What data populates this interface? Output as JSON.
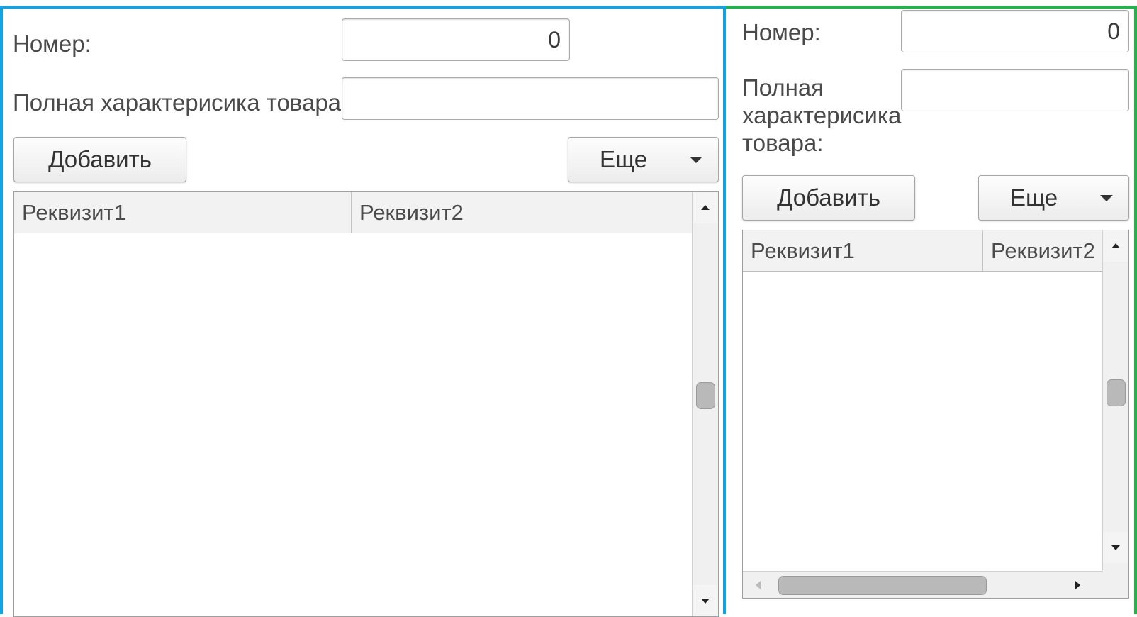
{
  "colors": {
    "left_border": "#14a3e0",
    "right_border": "#24b24b"
  },
  "left_form": {
    "number_label": "Номер:",
    "number_value": "0",
    "description_label": "Полная характерисика товара:",
    "description_value": "",
    "add_button": "Добавить",
    "more_button": "Еще",
    "table": {
      "columns": [
        "Реквизит1",
        "Реквизит2"
      ],
      "rows": []
    }
  },
  "right_form": {
    "number_label": "Номер:",
    "number_value": "0",
    "description_label": "Полная характерисика товара:",
    "description_value": "",
    "add_button": "Добавить",
    "more_button": "Еще",
    "table": {
      "columns": [
        "Реквизит1",
        "Реквизит2"
      ],
      "rows": []
    }
  }
}
